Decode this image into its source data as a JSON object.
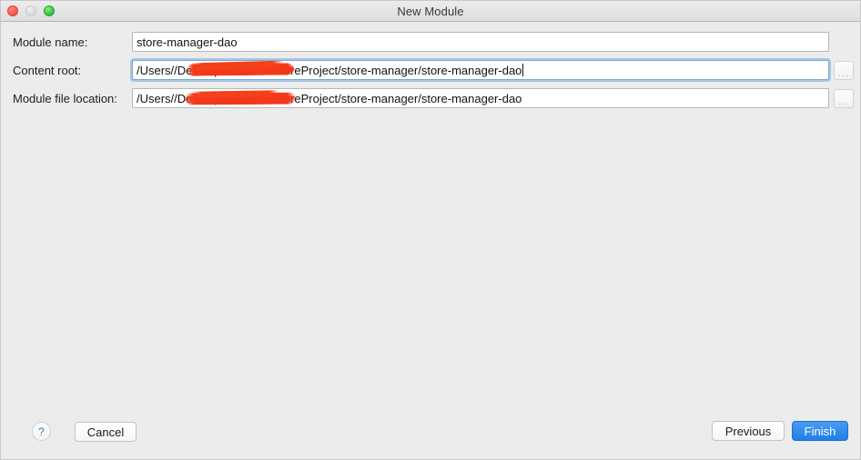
{
  "window": {
    "title": "New Module",
    "traffic_lights": [
      {
        "name": "close",
        "color": "#fc5753"
      },
      {
        "name": "minimize",
        "color": "#dcdcdc"
      },
      {
        "name": "maximize",
        "color": "#33c748"
      }
    ]
  },
  "form": {
    "module_name": {
      "label": "Module name:",
      "value": "store-manager-dao",
      "focused": false,
      "has_browse": false
    },
    "content_root": {
      "label": "Content root:",
      "value_prefix": "/Users/",
      "value_suffix": "/Desktop/ideaUser/storeProject/store-manager/store-manager-dao",
      "redacted_segment": true,
      "focused": true,
      "has_browse": true,
      "browse_label": "..."
    },
    "module_file_location": {
      "label": "Module file location:",
      "value_prefix": "/Users/",
      "value_suffix": "/Desktop/ideaUser/storeProject/store-manager/store-manager-dao",
      "redacted_segment": true,
      "focused": false,
      "has_browse": true,
      "browse_label": "..."
    }
  },
  "footer": {
    "help_label": "?",
    "cancel_label": "Cancel",
    "previous_label": "Previous",
    "finish_label": "Finish"
  },
  "colors": {
    "window_background": "#ececec",
    "titlebar_background": "#e4e4e4",
    "primary_button": "#1f7fe8",
    "focus_ring": "#74a7d8",
    "redaction": "#f4411a",
    "help_glyph": "#3b77bd"
  }
}
